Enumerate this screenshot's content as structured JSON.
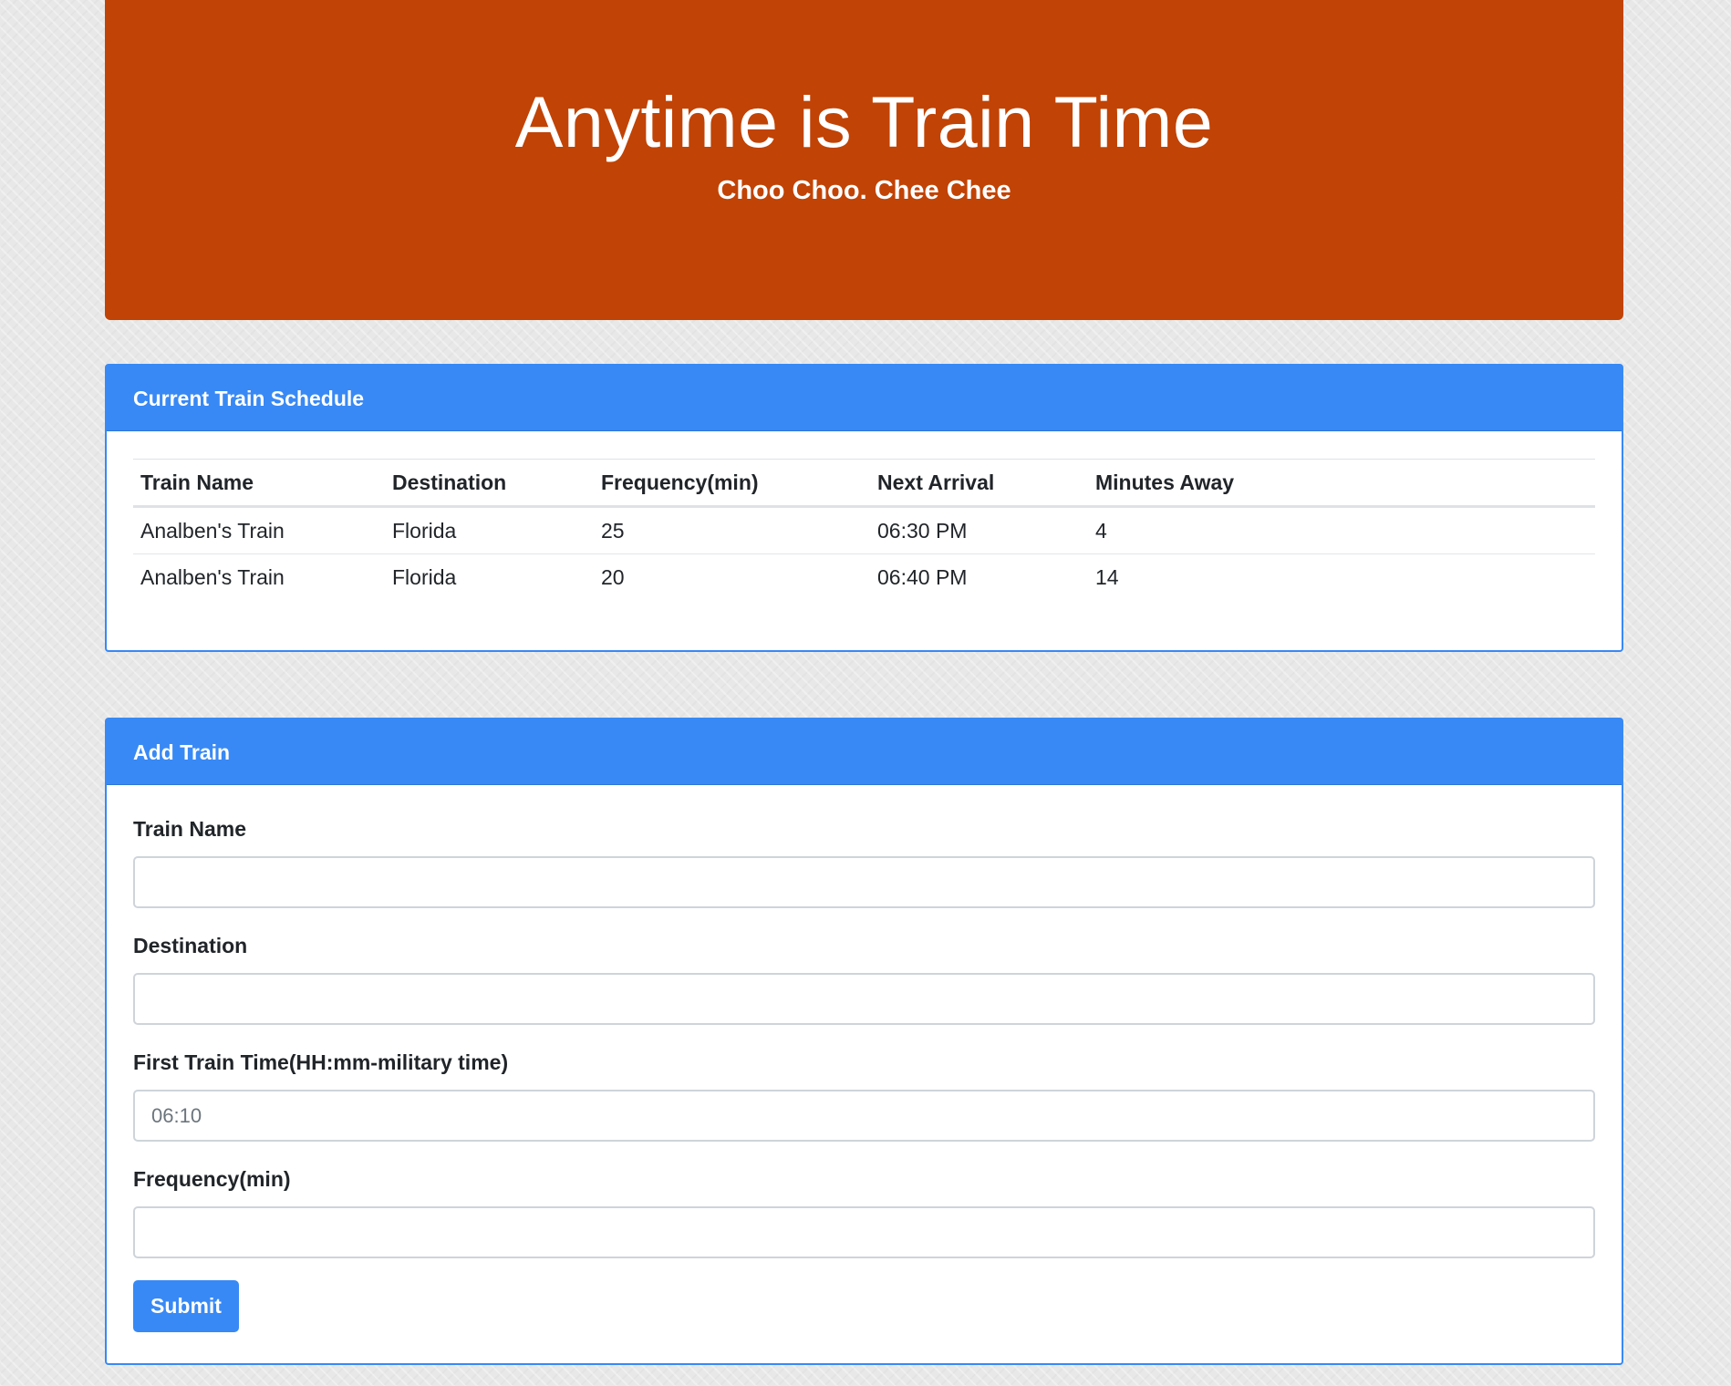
{
  "header": {
    "title": "Anytime is Train Time",
    "subtitle": "Choo Choo. Chee Chee"
  },
  "schedule": {
    "title": "Current Train Schedule",
    "columns": [
      "Train Name",
      "Destination",
      "Frequency(min)",
      "Next Arrival",
      "Minutes Away"
    ],
    "rows": [
      {
        "name": "Analben's Train",
        "destination": "Florida",
        "frequency": "25",
        "next_arrival": "06:30 PM",
        "minutes_away": "4"
      },
      {
        "name": "Analben's Train",
        "destination": "Florida",
        "frequency": "20",
        "next_arrival": "06:40 PM",
        "minutes_away": "14"
      }
    ]
  },
  "add_train": {
    "title": "Add Train",
    "fields": {
      "name": {
        "label": "Train Name",
        "value": "",
        "placeholder": ""
      },
      "destination": {
        "label": "Destination",
        "value": "",
        "placeholder": ""
      },
      "first_time": {
        "label": "First Train Time(HH:mm-military time)",
        "value": "",
        "placeholder": "06:10"
      },
      "frequency": {
        "label": "Frequency(min)",
        "value": "",
        "placeholder": ""
      }
    },
    "submit_label": "Submit"
  },
  "colors": {
    "header_bg": "#c14305",
    "card_accent": "#3889f5",
    "page_bg": "#e8e8e8"
  }
}
